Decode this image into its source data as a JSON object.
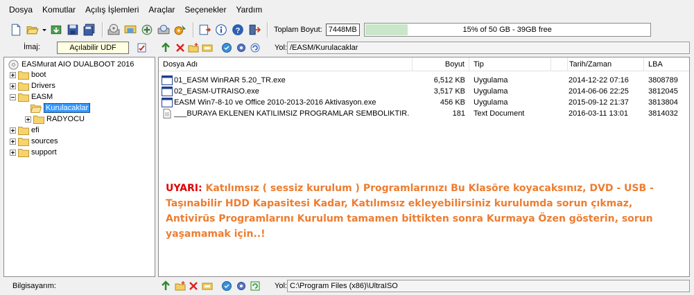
{
  "menu": [
    "Dosya",
    "Komutlar",
    "Açılış İşlemleri",
    "Araçlar",
    "Seçenekler",
    "Yardım"
  ],
  "toolbar": {
    "buttons": [
      "new-icon",
      "open-icon",
      "extract-icon",
      "save-icon",
      "save-as-icon",
      "burn-cd-icon",
      "mount-icon",
      "compress-icon",
      "checksum-icon",
      "virtual-drive-icon",
      "properties-icon",
      "info-icon",
      "help-icon",
      "exit-icon"
    ],
    "total_size_label": "Toplam Boyut:",
    "total_size_value": "7448MB",
    "capacity_text": "15% of 50 GB - 39GB free",
    "capacity_fraction": 0.15
  },
  "image_row": {
    "label": "İmaj:",
    "udf_button": "Açılabilir UDF",
    "path_label": "Yol:",
    "path": "/EASM/Kurulacaklar"
  },
  "tree": [
    {
      "label": "EASMurat AIO DUALBOOT 2016",
      "level": 0,
      "type": "cd"
    },
    {
      "label": "boot",
      "level": 1,
      "type": "folder",
      "exp": "plus"
    },
    {
      "label": "Drivers",
      "level": 1,
      "type": "folder",
      "exp": "plus"
    },
    {
      "label": "EASM",
      "level": 1,
      "type": "folder",
      "exp": "minus"
    },
    {
      "label": "Kurulacaklar",
      "level": 2,
      "type": "folder-open",
      "exp": "",
      "selected": true
    },
    {
      "label": "RADYOCU",
      "level": 2,
      "type": "folder",
      "exp": "plus"
    },
    {
      "label": "efi",
      "level": 1,
      "type": "folder",
      "exp": "plus"
    },
    {
      "label": "sources",
      "level": 1,
      "type": "folder",
      "exp": "plus"
    },
    {
      "label": "support",
      "level": 1,
      "type": "folder",
      "exp": "plus"
    }
  ],
  "file_list": {
    "columns": [
      "Dosya Adı",
      "Boyut",
      "Tip",
      "Tarih/Zaman",
      "LBA"
    ],
    "rows": [
      {
        "name": "01_EASM WinRAR 5.20_TR.exe",
        "size": "6,512 KB",
        "type": "Uygulama",
        "date": "2014-12-22 07:16",
        "lba": "3808789",
        "icon": "exe-icon"
      },
      {
        "name": "02_EASM-UTRAISO.exe",
        "size": "3,517 KB",
        "type": "Uygulama",
        "date": "2014-06-06 22:25",
        "lba": "3812045",
        "icon": "exe-icon"
      },
      {
        "name": "EASM Win7-8-10 ve Office 2010-2013-2016 Aktivasyon.exe",
        "size": "456 KB",
        "type": "Uygulama",
        "date": "2015-09-12 21:37",
        "lba": "3813804",
        "icon": "exe-icon"
      },
      {
        "name": "___BURAYA EKLENEN KATILIMSIZ PROGRAMLAR SEMBOLIKTIR....",
        "size": "181",
        "type": "Text Document",
        "date": "2016-03-11 13:01",
        "lba": "3814032",
        "icon": "text-file-icon"
      }
    ]
  },
  "warning": {
    "lead": "UYARI:",
    "text": "Katılımsız ( sessiz kurulum ) Programlarınızı Bu Klasöre koyacaksınız, DVD - USB - Taşınabilir HDD Kapasitesi Kadar, Katılımsız ekleyebilirsiniz kurulumda sorun çıkmaz, Antivirüs Programlarını Kurulum tamamen bittikten sonra Kurmaya Özen gösterin, sorun yaşamamak için..!"
  },
  "bottom_row": {
    "label": "Bilgisayarım:",
    "path_label": "Yol:",
    "path": "C:\\Program Files (x86)\\UltraISO"
  },
  "colors": {
    "warning_lead": "#e00000",
    "warning_text": "#ed7d31",
    "selection": "#3399ff",
    "udf_background": "#ffffe1",
    "capacity_fill": "#c9e6c9"
  }
}
